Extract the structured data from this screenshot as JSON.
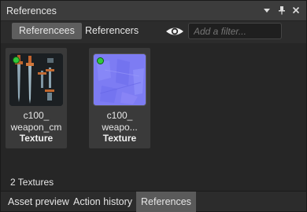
{
  "window": {
    "title": "References"
  },
  "toolbar": {
    "tabs": [
      "Referencees",
      "Referencers"
    ],
    "active_tab": "Referencees",
    "filter_placeholder": "Add a filter..."
  },
  "assets": [
    {
      "name_line1": "c100_",
      "name_line2": "weapon_cm",
      "type": "Texture",
      "status": "loaded",
      "thumbnail": "weapon-texture"
    },
    {
      "name_line1": "c100_",
      "name_line2": "weapo...",
      "type": "Texture",
      "status": "loaded",
      "thumbnail": "normal-map"
    }
  ],
  "status": {
    "count": "2 Textures"
  },
  "bottom_tabs": [
    "Asset preview",
    "Action history",
    "References"
  ],
  "active_bottom_tab": "References",
  "colors": {
    "status_green": "#31c83a",
    "active_tab_bg": "#5e5e5e",
    "normal_map": "#7f7ff5"
  }
}
